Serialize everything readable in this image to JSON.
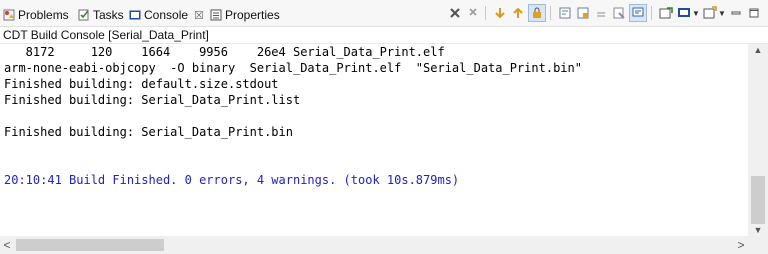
{
  "tabs": [
    {
      "label": "Problems",
      "icon": "problems-icon",
      "active": false
    },
    {
      "label": "Tasks",
      "icon": "tasks-icon",
      "active": false
    },
    {
      "label": "Console",
      "icon": "console-icon",
      "active": true,
      "close": "☒"
    },
    {
      "label": "Properties",
      "icon": "properties-icon",
      "active": false
    }
  ],
  "toolbar": {
    "icons": [
      "close-console-icon",
      "scroll-lock-icon",
      "word-wrap-icon",
      "pin-console-icon",
      "clear-console-icon",
      "display-selected-icon",
      "open-console-icon",
      "minimize-icon",
      "maximize-icon"
    ]
  },
  "console_title": "CDT Build Console [Serial_Data_Print]",
  "output": {
    "line1": "   8172     120    1664    9956    26e4 Serial_Data_Print.elf",
    "line2": "arm-none-eabi-objcopy  -O binary  Serial_Data_Print.elf  \"Serial_Data_Print.bin\"",
    "line3": "Finished building: default.size.stdout",
    "line4": "Finished building: Serial_Data_Print.list",
    "line5": "",
    "line6": "Finished building: Serial_Data_Print.bin",
    "line7": "",
    "line8": "",
    "line9": "20:10:41 Build Finished. 0 errors, 4 warnings. (took 10s.879ms)"
  },
  "colors": {
    "build_finished_text": "#1e22c8",
    "tab_bar_bg": "#f7f7f7"
  },
  "scrollbars": {
    "left_arrow": "<",
    "right_arrow": ">"
  }
}
